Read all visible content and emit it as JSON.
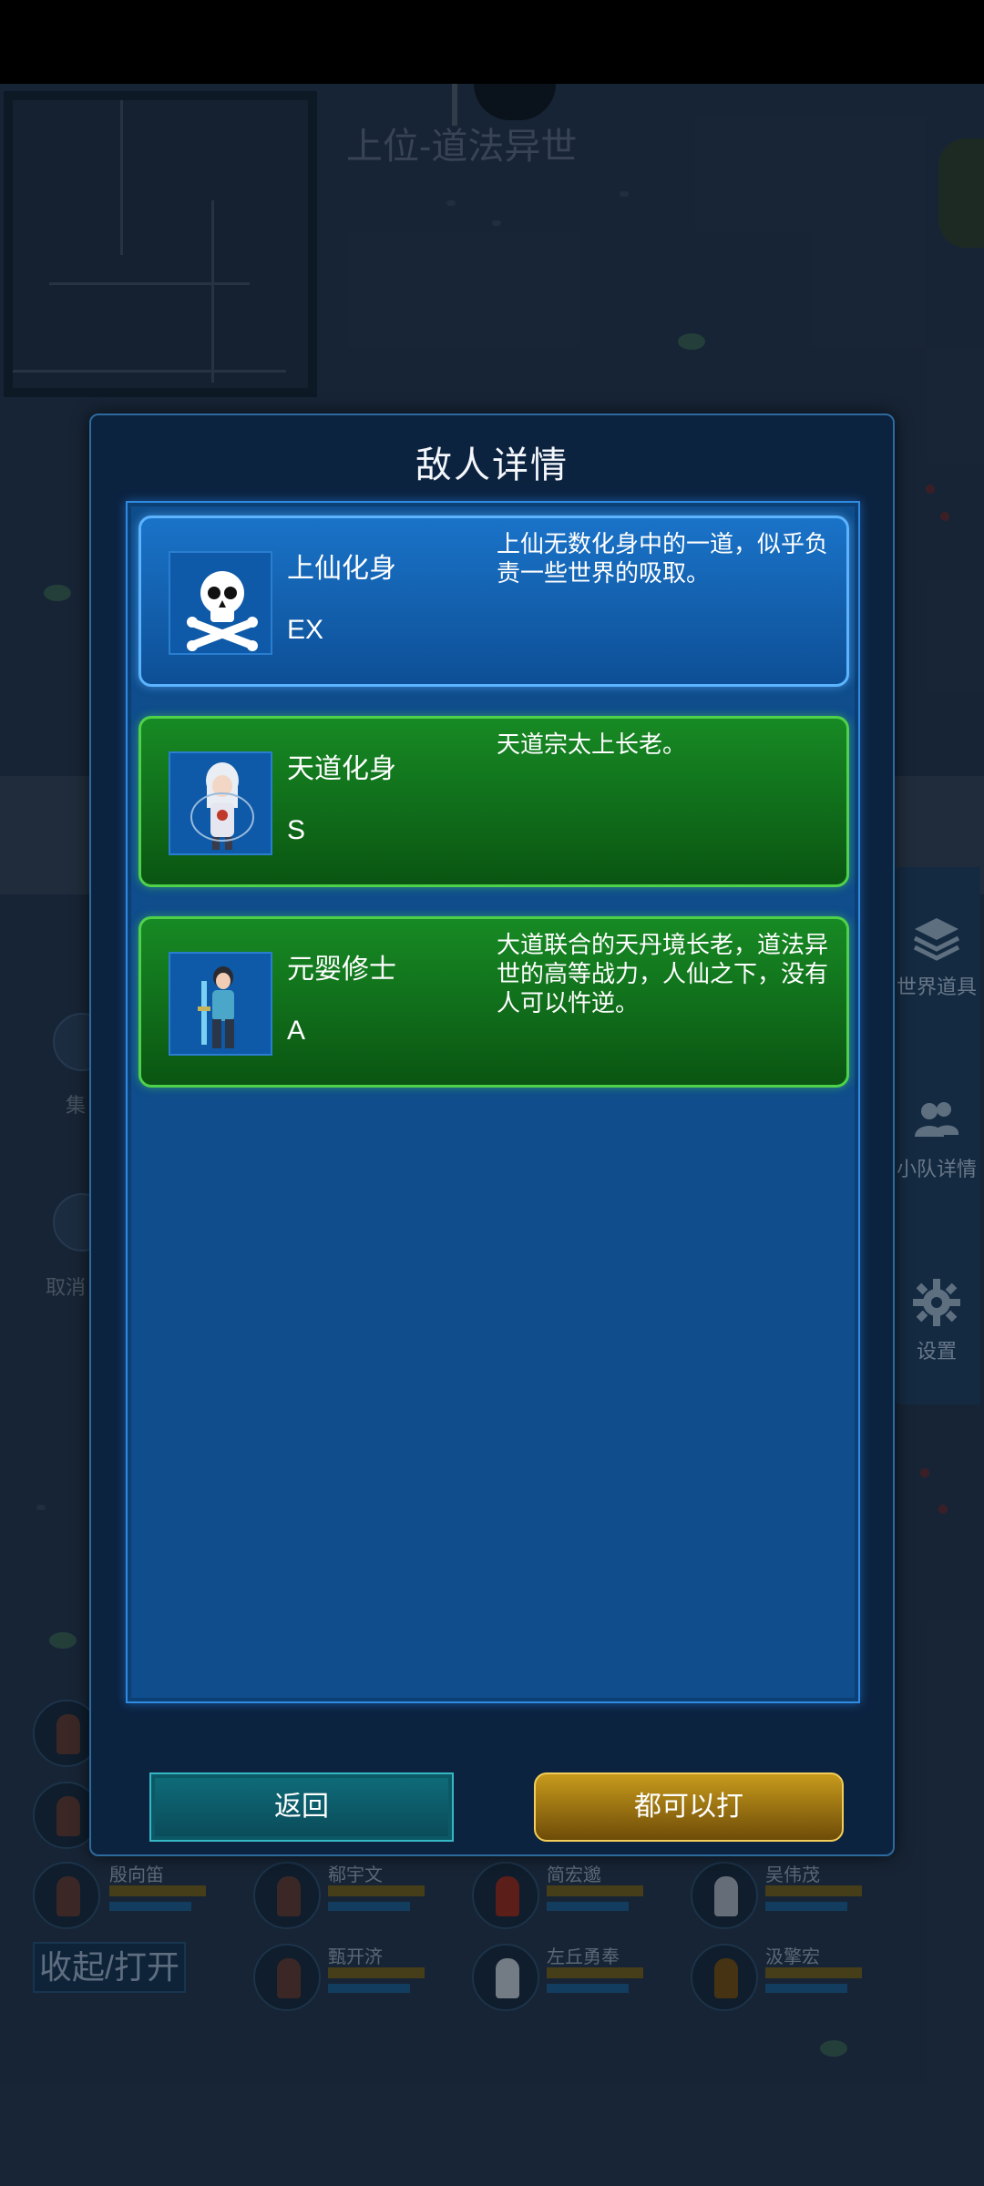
{
  "world": {
    "title": "上位-道法异世"
  },
  "side_buttons": {
    "gather_label": "集",
    "cancel_label": "取消"
  },
  "right_panel": {
    "items": [
      {
        "label": "世界道具",
        "icon": "layers-icon"
      },
      {
        "label": "小队详情",
        "icon": "team-icon"
      },
      {
        "label": "设置",
        "icon": "gear-icon"
      }
    ]
  },
  "roster": {
    "members": [
      {
        "name": "殷向笛"
      },
      {
        "name": "郗宇文"
      },
      {
        "name": "简宏邈"
      },
      {
        "name": "吴伟茂"
      },
      {
        "name": "甄开济"
      },
      {
        "name": "左丘勇奉"
      },
      {
        "name": "汲擎宏"
      }
    ],
    "collapse_label": "收起/打开"
  },
  "modal": {
    "title": "敌人详情",
    "enemies": [
      {
        "name": "上仙化身",
        "rank": "EX",
        "description": "上仙无数化身中的一道，似乎负责一些世界的吸取。",
        "color": "#1a73c8",
        "portrait": "skull-icon"
      },
      {
        "name": "天道化身",
        "rank": "S",
        "description": "天道宗太上长老。",
        "color": "#178a24",
        "portrait": "white-haired-girl-sprite"
      },
      {
        "name": "元婴修士",
        "rank": "A",
        "description": "大道联合的天丹境长老，道法异世的高等战力，人仙之下，没有人可以忤逆。",
        "color": "#178a24",
        "portrait": "swordsman-sprite"
      }
    ],
    "back_label": "返回",
    "fight_label": "都可以打"
  }
}
